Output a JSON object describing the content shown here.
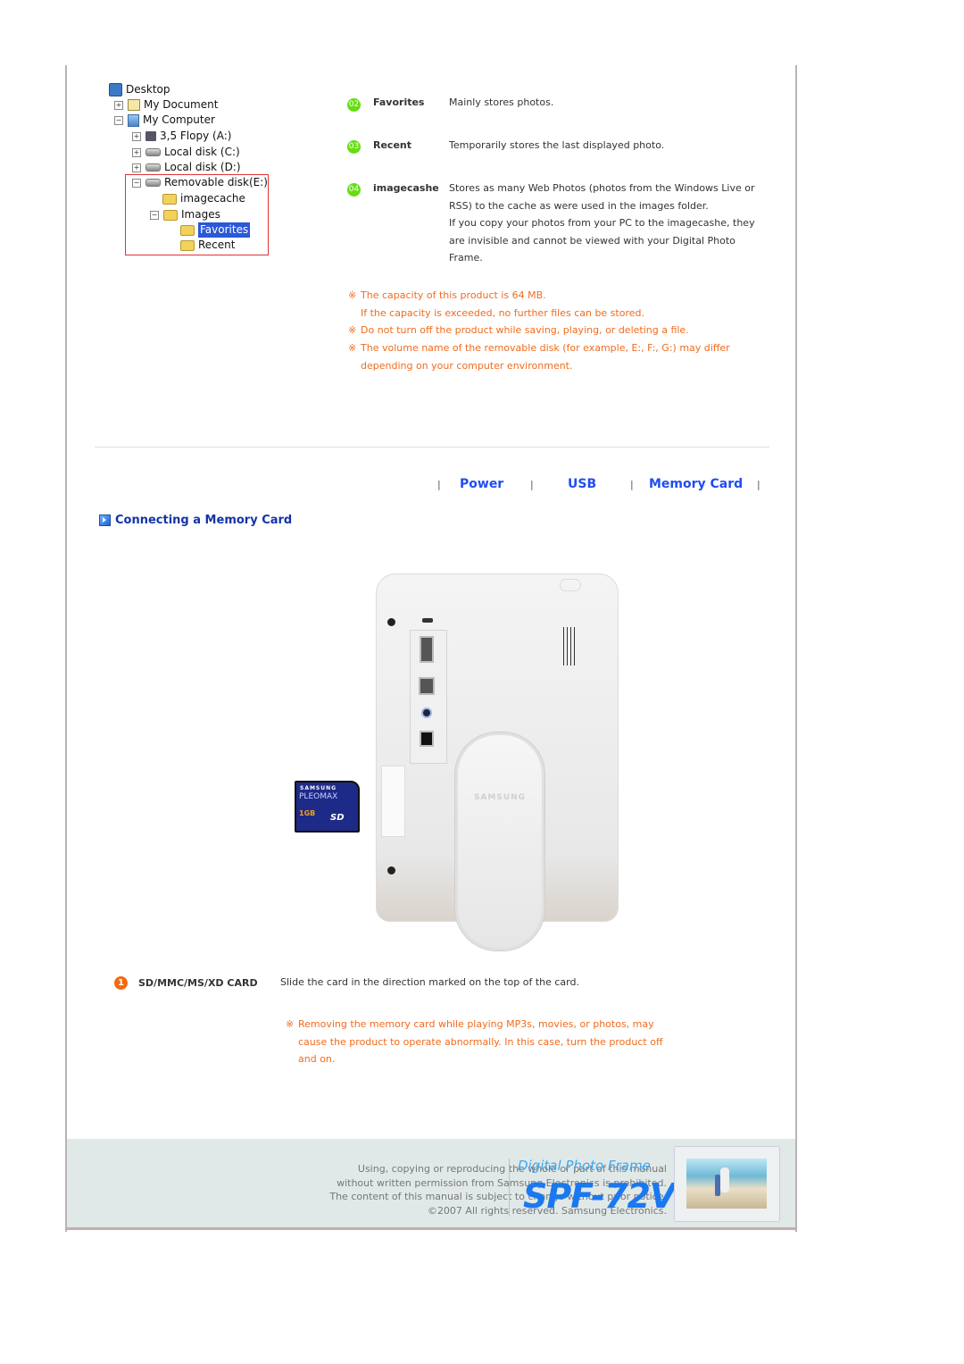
{
  "explorer_tree": {
    "items": [
      {
        "label": "Desktop",
        "icon": "desktop-icon",
        "expander": ""
      },
      {
        "label": "My Document",
        "icon": "document-icon",
        "expander": "+"
      },
      {
        "label": "My Computer",
        "icon": "computer-icon",
        "expander": "−"
      },
      {
        "label": "3,5 Flopy  (A:)",
        "icon": "floppy-icon",
        "expander": "+"
      },
      {
        "label": "Local disk (C:)",
        "icon": "disk-icon",
        "expander": "+"
      },
      {
        "label": "Local disk (D:)",
        "icon": "disk-icon",
        "expander": "+"
      },
      {
        "label": "Removable disk(E:)",
        "icon": "removable-disk-icon",
        "expander": "−"
      },
      {
        "label": "imagecache",
        "icon": "folder-icon",
        "expander": ""
      },
      {
        "label": "Images",
        "icon": "folder-icon",
        "expander": "−"
      },
      {
        "label": "Favorites",
        "icon": "folder-icon",
        "expander": "",
        "selected": true
      },
      {
        "label": "Recent",
        "icon": "folder-icon",
        "expander": ""
      }
    ],
    "highlight_color": "#e03434"
  },
  "definitions": [
    {
      "number": "02",
      "term": "Favorites",
      "lines": [
        "Mainly stores photos."
      ]
    },
    {
      "number": "03",
      "term": "Recent",
      "lines": [
        "Temporarily stores the last displayed photo."
      ]
    },
    {
      "number": "04",
      "term": "imagecashe",
      "lines": [
        "Stores as many Web Photos (photos from the Windows Live or",
        "RSS) to the cache as were used in the images folder.",
        "If you copy your photos from your PC to the imagecashe, they",
        "are invisible and cannot be viewed with your Digital Photo",
        "Frame."
      ]
    }
  ],
  "notes_top": {
    "mark": "※",
    "lines": [
      {
        "mark": true,
        "text": "The capacity of this product is 64 MB."
      },
      {
        "mark": false,
        "text": "If the capacity is exceeded, no further files can be stored."
      },
      {
        "mark": true,
        "text": "Do not turn off the product while saving, playing, or deleting a file."
      },
      {
        "mark": true,
        "text": "The volume name of the removable disk (for example, E:, F:, G:) may differ"
      },
      {
        "mark": false,
        "text": "depending on your computer environment."
      }
    ]
  },
  "nav": {
    "separator": "|",
    "links": [
      "Power",
      "USB",
      "Memory Card"
    ]
  },
  "section": {
    "title": "Connecting a Memory Card"
  },
  "illustration": {
    "card_brand": "SAMSUNG",
    "card_model": "PLEOMAX",
    "card_capacity": "1GB",
    "card_logo": "SD",
    "stand_logo": "SAMSUNG"
  },
  "card_item": {
    "number": "1",
    "term": "SD/MMC/MS/XD CARD",
    "desc": "Slide the card in the direction marked on the top of the card."
  },
  "notes_bottom": {
    "mark": "※",
    "lines": [
      "Removing the memory card while playing MP3s, movies, or photos, may",
      "cause the product to operate abnormally. In this case, turn the product off",
      "and on."
    ]
  },
  "footer": {
    "legal": [
      "Using, copying or reproducing the whole or part of this manual",
      "without written permission from Samsung Electronics  is prohibited.",
      "The content of this manual is subject to change without prior notice.",
      "©2007 All rights reserved. Samsung Electronics."
    ],
    "product_line": "Digital Photo Frame",
    "model": "SPF-72V"
  },
  "colors": {
    "badge_green": "#66dd11",
    "badge_orange": "#f06a10",
    "note_orange": "#f26b1d",
    "nav_blue": "#1f4ef0",
    "heading_blue": "#1433a8"
  }
}
